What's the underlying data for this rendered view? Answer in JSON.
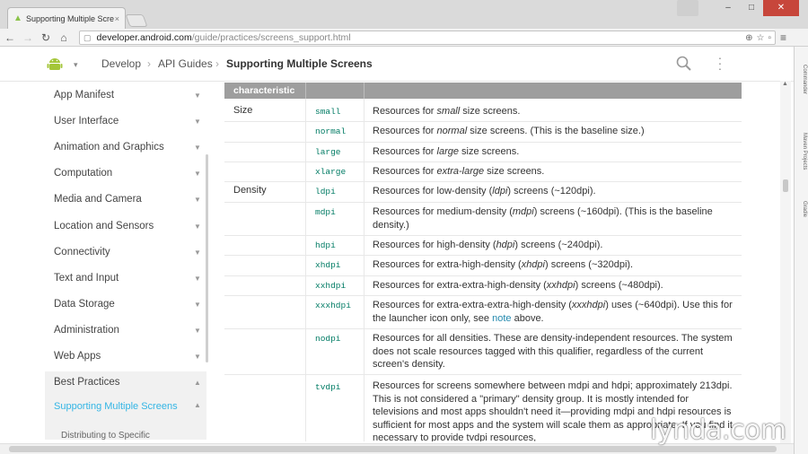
{
  "browser": {
    "tab_title": "Supporting Multiple Scre",
    "tab_close": "×",
    "url_host": "developer.android.com",
    "url_path": "/guide/practices/screens_support.html",
    "window_minimize": "–",
    "window_maximize": "□",
    "window_close": "✕"
  },
  "site_header": {
    "breadcrumbs": [
      "Develop",
      "API Guides",
      "Supporting Multiple Screens"
    ],
    "separator": "›"
  },
  "left_nav": {
    "items": [
      {
        "label": "App Manifest"
      },
      {
        "label": "User Interface"
      },
      {
        "label": "Animation and Graphics"
      },
      {
        "label": "Computation"
      },
      {
        "label": "Media and Camera"
      },
      {
        "label": "Location and Sensors"
      },
      {
        "label": "Connectivity"
      },
      {
        "label": "Text and Input"
      },
      {
        "label": "Data Storage"
      },
      {
        "label": "Administration"
      },
      {
        "label": "Web Apps"
      },
      {
        "label": "Best Practices"
      },
      {
        "label": "Supporting Multiple Screens"
      }
    ],
    "sub_item": "Distributing to Specific"
  },
  "table": {
    "header_characteristic": "characteristic",
    "rows": [
      {
        "characteristic": "Size",
        "qualifier": "small",
        "desc_pre": "Resources for ",
        "desc_em": "small",
        "desc_post": " size screens."
      },
      {
        "characteristic": "",
        "qualifier": "normal",
        "desc_pre": "Resources for ",
        "desc_em": "normal",
        "desc_post": " size screens. (This is the baseline size.)"
      },
      {
        "characteristic": "",
        "qualifier": "large",
        "desc_pre": "Resources for ",
        "desc_em": "large",
        "desc_post": " size screens."
      },
      {
        "characteristic": "",
        "qualifier": "xlarge",
        "desc_pre": "Resources for ",
        "desc_em": "extra-large",
        "desc_post": " size screens."
      },
      {
        "characteristic": "Density",
        "qualifier": "ldpi",
        "desc_pre": "Resources for low-density (",
        "desc_em": "ldpi",
        "desc_post": ") screens (~120dpi)."
      },
      {
        "characteristic": "",
        "qualifier": "mdpi",
        "desc_pre": "Resources for medium-density (",
        "desc_em": "mdpi",
        "desc_post": ") screens (~160dpi). (This is the baseline density.)"
      },
      {
        "characteristic": "",
        "qualifier": "hdpi",
        "desc_pre": "Resources for high-density (",
        "desc_em": "hdpi",
        "desc_post": ") screens (~240dpi)."
      },
      {
        "characteristic": "",
        "qualifier": "xhdpi",
        "desc_pre": "Resources for extra-high-density (",
        "desc_em": "xhdpi",
        "desc_post": ") screens (~320dpi)."
      },
      {
        "characteristic": "",
        "qualifier": "xxhdpi",
        "desc_pre": "Resources for extra-extra-high-density (",
        "desc_em": "xxhdpi",
        "desc_post": ") screens (~480dpi)."
      },
      {
        "characteristic": "",
        "qualifier": "xxxhdpi",
        "desc_pre": "Resources for extra-extra-extra-high-density (",
        "desc_em": "xxxhdpi",
        "desc_post": ") uses (~640dpi). Use this for the launcher icon only, see ",
        "desc_link": "note",
        "desc_tail": " above."
      },
      {
        "characteristic": "",
        "qualifier": "nodpi",
        "desc_pre": "Resources for all densities. These are density-independent resources. The system does not scale resources tagged with this qualifier, regardless of the current screen's density.",
        "desc_em": "",
        "desc_post": ""
      },
      {
        "characteristic": "",
        "qualifier": "tvdpi",
        "desc_pre": "Resources for screens somewhere between mdpi and hdpi; approximately 213dpi. This is not considered a \"primary\" density group. It is mostly intended for televisions and most apps shouldn't need it—providing mdpi and hdpi resources is sufficient for most apps and the system will scale them as appropriate. If you find it necessary to provide tvdpi resources,",
        "desc_em": "",
        "desc_post": ""
      }
    ]
  },
  "extensions": [
    "Commander",
    "Maven Projects",
    "Gradle"
  ],
  "watermark": "lynda.com",
  "colors": {
    "accent": "#33b5e5",
    "qualifier": "#007b64",
    "table_header": "#9e9e9e",
    "link": "#258aaf"
  }
}
